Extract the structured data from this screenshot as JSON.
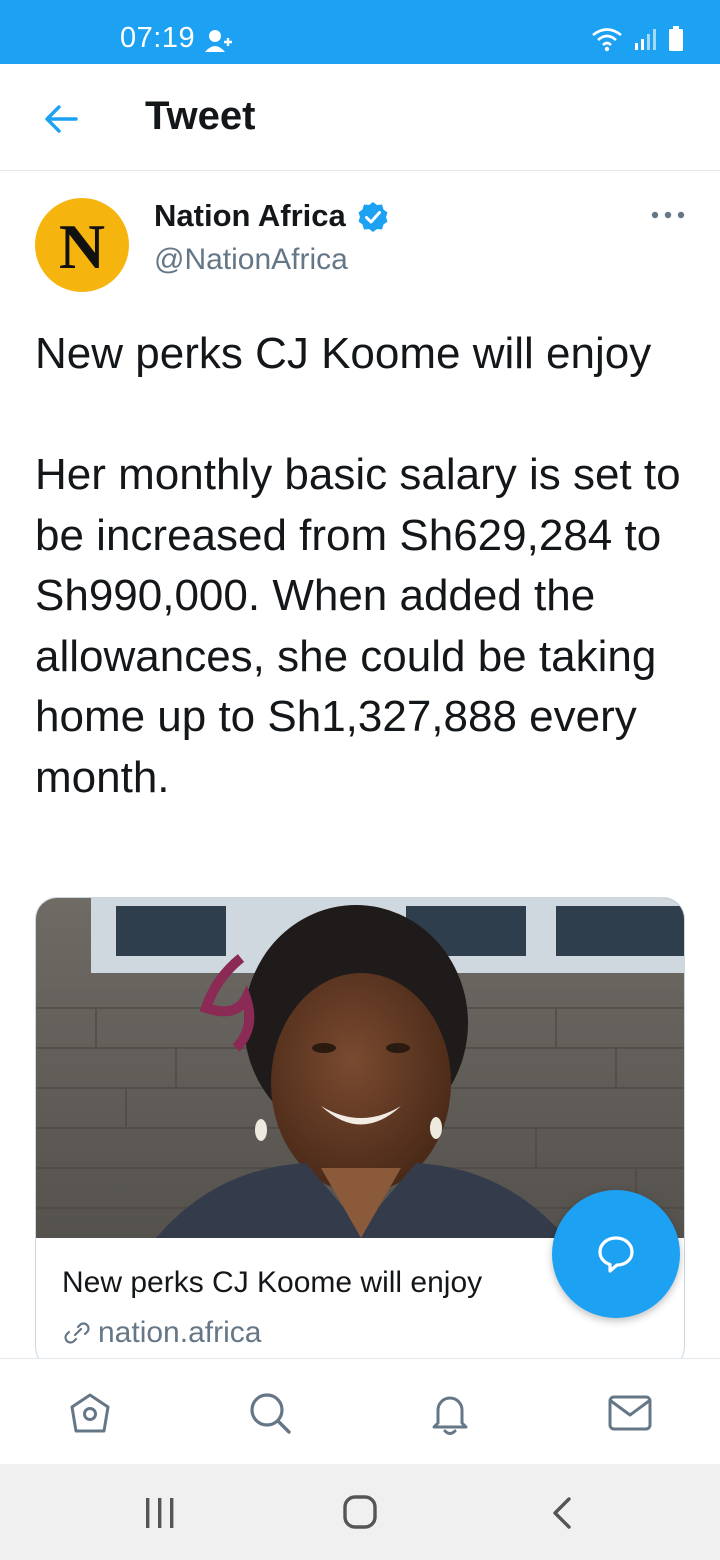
{
  "status_bar": {
    "time": "07:19"
  },
  "header": {
    "title": "Tweet"
  },
  "tweet": {
    "author_name": "Nation Africa",
    "author_handle": "@NationAfrica",
    "avatar_letter": "N",
    "text": "New perks CJ Koome will enjoy\n\nHer monthly basic salary is set to be increased from Sh629,284 to Sh990,000. When added the allowances, she could be taking home up to Sh1,327,888 every month.",
    "card": {
      "title": "New perks CJ Koome will enjoy",
      "domain": "nation.africa"
    }
  },
  "icons": {
    "back": "back-arrow-icon",
    "more": "more-options-icon",
    "verified": "verified-badge-icon",
    "compose": "compose-reply-icon",
    "nav": [
      "home-icon",
      "search-icon",
      "notifications-icon",
      "messages-icon"
    ]
  },
  "colors": {
    "accent": "#1da1f2",
    "avatar_bg": "#f6b40f",
    "secondary_text": "#657786"
  }
}
